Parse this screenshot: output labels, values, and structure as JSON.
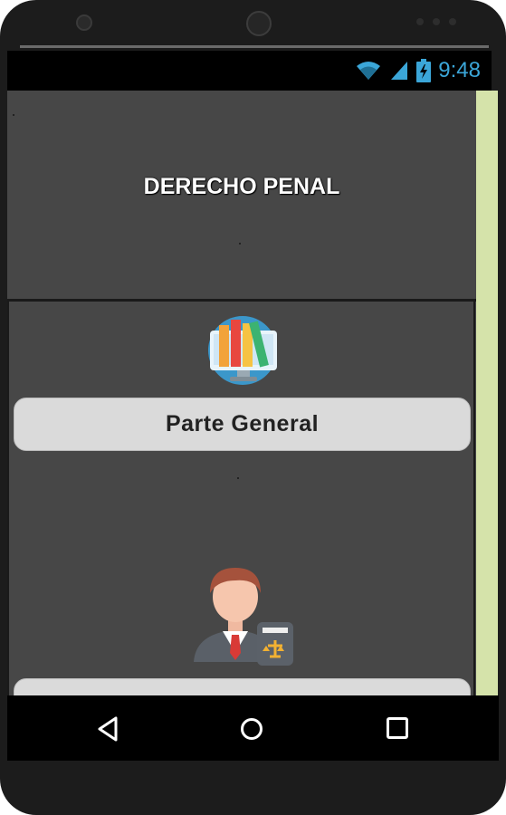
{
  "status": {
    "time": "9:48",
    "icons": [
      "wifi-icon",
      "signal-icon",
      "battery-charging-icon"
    ],
    "accent_color": "#3ba6d8"
  },
  "header": {
    "title": "DERECHO PENAL"
  },
  "sections": [
    {
      "icon": "books-monitor-icon",
      "button_label": "Parte General"
    },
    {
      "icon": "lawyer-icon",
      "button_label": ""
    }
  ],
  "navigation": {
    "buttons": [
      "back-icon",
      "home-icon",
      "recents-icon"
    ]
  },
  "colors": {
    "screen_bg": "#474747",
    "button_bg": "#dadada",
    "scrollbar": "#d5e3aa"
  }
}
